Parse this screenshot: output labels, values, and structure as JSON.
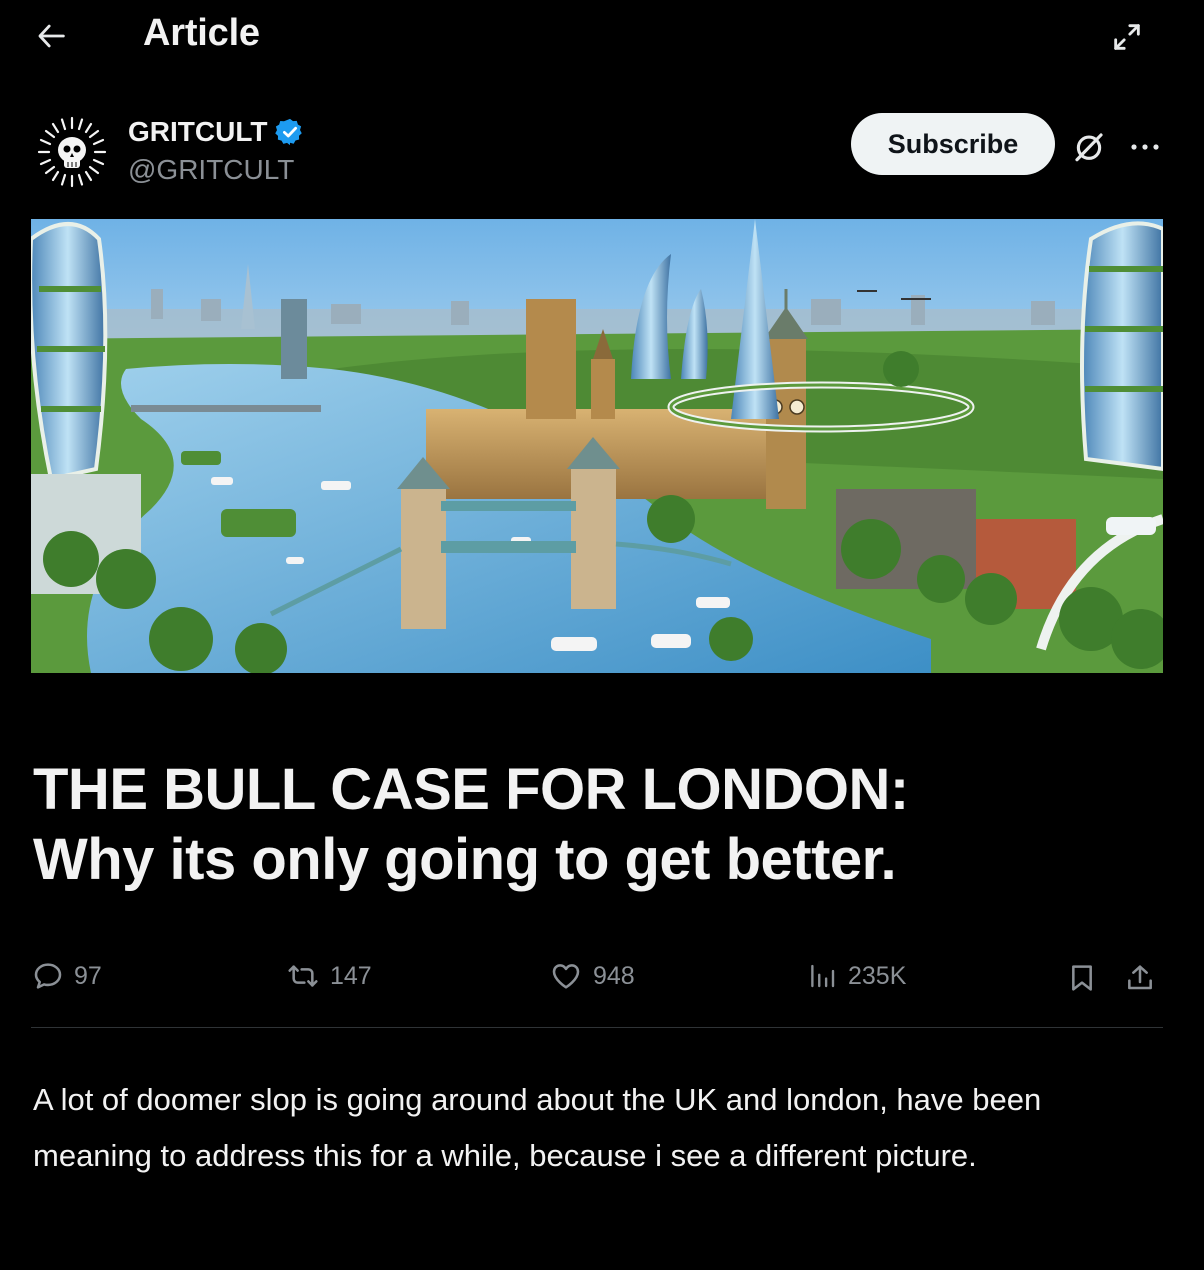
{
  "header": {
    "title": "Article",
    "back_icon": "arrow-left-icon",
    "expand_icon": "expand-icon"
  },
  "author": {
    "name": "GRITCULT",
    "handle": "@GRITCULT",
    "verified": true,
    "verified_color": "#1d9bf0",
    "subscribe_label": "Subscribe",
    "grok_icon": "grok-icon",
    "more_icon": "more-icon"
  },
  "cover_image": {
    "alt": "Futuristic London skyline with Tower Bridge, Big Ben, and green skyscrapers along the Thames"
  },
  "article": {
    "title_line1": "THE BULL CASE FOR LONDON:",
    "title_line2": "Why its only going to get better.",
    "body": "A lot of doomer slop is going around about the UK and london, have been meaning to address this for a while, because i see a different picture."
  },
  "stats": {
    "replies": "97",
    "reposts": "147",
    "likes": "948",
    "views": "235K"
  },
  "colors": {
    "background": "#000000",
    "text_primary": "#f2f2f2",
    "text_secondary": "#8b9096",
    "divider": "#2f3336",
    "subscribe_bg": "#eff3f4"
  }
}
